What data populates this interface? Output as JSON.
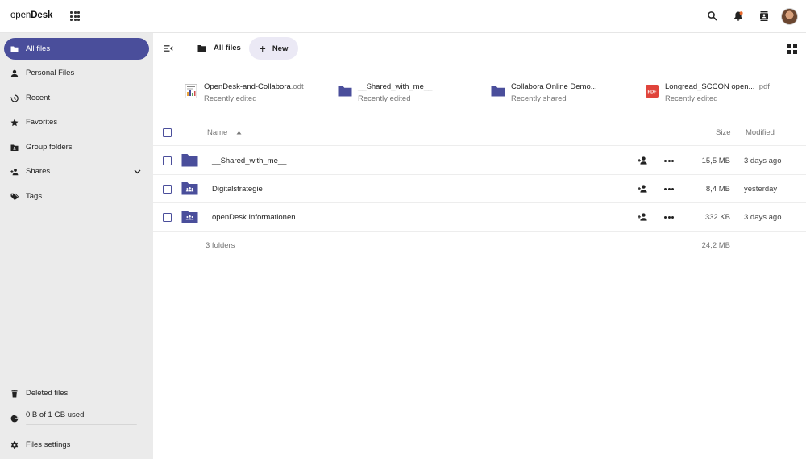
{
  "header": {
    "brand_prefix": "open",
    "brand_bold": "Desk",
    "icons": [
      "apps-grid-icon",
      "search-icon",
      "notifications-icon",
      "contacts-icon",
      "avatar"
    ]
  },
  "sidebar": {
    "items": [
      {
        "label": "All files",
        "icon": "folder-icon",
        "active": true
      },
      {
        "label": "Personal Files",
        "icon": "person-icon"
      },
      {
        "label": "Recent",
        "icon": "history-icon"
      },
      {
        "label": "Favorites",
        "icon": "star-icon"
      },
      {
        "label": "Group folders",
        "icon": "group-folder-icon"
      },
      {
        "label": "Shares",
        "icon": "share-icon"
      },
      {
        "label": "Tags",
        "icon": "tag-icon"
      }
    ],
    "deleted_label": "Deleted files",
    "quota_label": "0 B of 1 GB used",
    "settings_label": "Files settings"
  },
  "toolbar": {
    "breadcrumb": "All files",
    "new_label": "New"
  },
  "recent": [
    {
      "name": "OpenDesk-and-Collabora",
      "ext": ".odt",
      "sub": "Recently edited",
      "type": "document"
    },
    {
      "name": "__Shared_with_me__",
      "ext": "",
      "sub": "Recently edited",
      "type": "folder"
    },
    {
      "name": "Collabora Online Demo...",
      "ext": "",
      "sub": "Recently shared",
      "type": "folder"
    },
    {
      "name": "Longread_SCCON open...",
      "ext": " .pdf",
      "sub": "Recently edited",
      "type": "pdf"
    }
  ],
  "table": {
    "headers": {
      "name": "Name",
      "size": "Size",
      "modified": "Modified"
    },
    "rows": [
      {
        "name": "__Shared_with_me__",
        "size": "15,5 MB",
        "modified": "3 days ago",
        "kind": "folder"
      },
      {
        "name": "Digitalstrategie",
        "size": "8,4 MB",
        "modified": "yesterday",
        "kind": "group-folder"
      },
      {
        "name": "openDesk Informationen",
        "size": "332 KB",
        "modified": "3 days ago",
        "kind": "group-folder"
      }
    ],
    "summary_count": "3 folders",
    "summary_size": "24,2 MB"
  },
  "colors": {
    "accent": "#4a4e9b",
    "sidebar_bg": "#ebebeb",
    "new_button_bg": "#ebe9f5",
    "notification_dot": "#e8692c",
    "pdf_red": "#e0443b"
  }
}
